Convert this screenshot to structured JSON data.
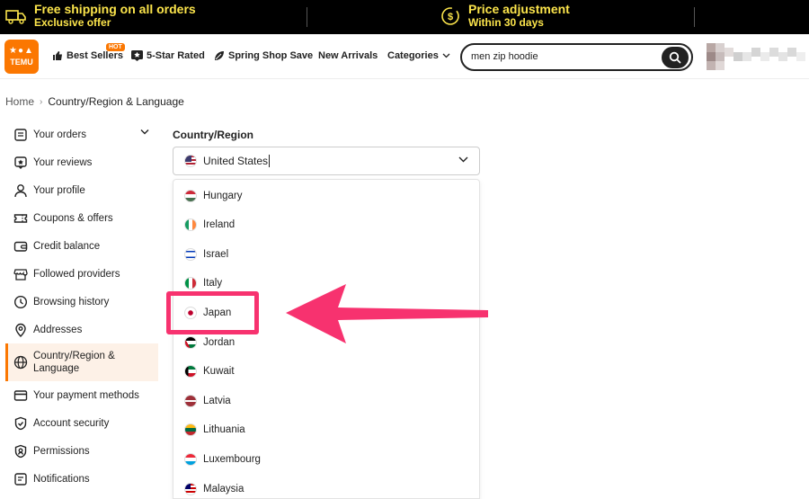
{
  "promo": {
    "left_title": "Free shipping on all orders",
    "left_sub": "Exclusive offer",
    "right_title": "Price adjustment",
    "right_sub": "Within 30 days"
  },
  "header": {
    "logo_text_1": "TEMU",
    "nav": {
      "best_sellers": "Best Sellers",
      "hot_badge": "HOT",
      "five_star": "5-Star Rated",
      "spring": "Spring Shop Save",
      "new_arrivals": "New Arrivals",
      "categories": "Categories"
    },
    "search_value": "men zip hoodie"
  },
  "breadcrumb": {
    "home": "Home",
    "current": "Country/Region & Language"
  },
  "sidebar": {
    "items": [
      {
        "label": "Your orders",
        "icon": "orders-icon"
      },
      {
        "label": "Your reviews",
        "icon": "reviews-icon"
      },
      {
        "label": "Your profile",
        "icon": "profile-icon"
      },
      {
        "label": "Coupons & offers",
        "icon": "coupon-icon"
      },
      {
        "label": "Credit balance",
        "icon": "wallet-icon"
      },
      {
        "label": "Followed providers",
        "icon": "store-icon"
      },
      {
        "label": "Browsing history",
        "icon": "clock-icon"
      },
      {
        "label": "Addresses",
        "icon": "location-icon"
      },
      {
        "label": "Country/Region & Language",
        "icon": "globe-icon"
      },
      {
        "label": "Your payment methods",
        "icon": "card-icon"
      },
      {
        "label": "Account security",
        "icon": "shield-icon"
      },
      {
        "label": "Permissions",
        "icon": "permissions-icon"
      },
      {
        "label": "Notifications",
        "icon": "bell-icon"
      }
    ]
  },
  "main": {
    "country_label": "Country/Region",
    "selected": "United States",
    "options": [
      "Hungary",
      "Ireland",
      "Israel",
      "Italy",
      "Japan",
      "Jordan",
      "Kuwait",
      "Latvia",
      "Lithuania",
      "Luxembourg",
      "Malaysia"
    ]
  },
  "colors": {
    "accent": "#fb7701",
    "promo_text": "#fbe44b",
    "annotation": "#f7326f"
  }
}
